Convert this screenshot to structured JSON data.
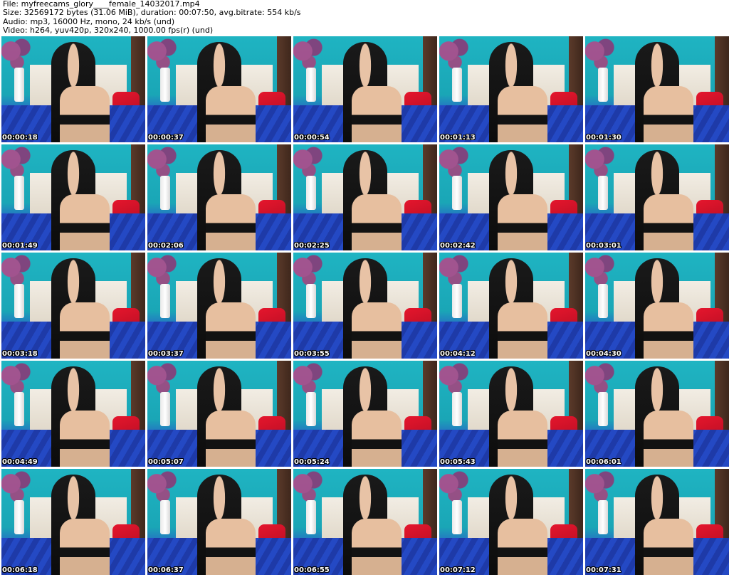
{
  "header": {
    "file_line": "File: myfreecams_glory____female_14032017.mp4",
    "size_line": "Size: 32569172 bytes (31.06 MiB), duration: 00:07:50, avg.bitrate: 554 kb/s",
    "audio_line": "Audio: mp3, 16000 Hz, mono, 24 kb/s (und)",
    "video_line": "Video: h264, yuv420p, 320x240, 1000.00 fps(r) (und)"
  },
  "thumbnails": [
    {
      "timestamp": "00:00:18"
    },
    {
      "timestamp": "00:00:37"
    },
    {
      "timestamp": "00:00:54"
    },
    {
      "timestamp": "00:01:13"
    },
    {
      "timestamp": "00:01:30"
    },
    {
      "timestamp": "00:01:49"
    },
    {
      "timestamp": "00:02:06"
    },
    {
      "timestamp": "00:02:25"
    },
    {
      "timestamp": "00:02:42"
    },
    {
      "timestamp": "00:03:01"
    },
    {
      "timestamp": "00:03:18"
    },
    {
      "timestamp": "00:03:37"
    },
    {
      "timestamp": "00:03:55"
    },
    {
      "timestamp": "00:04:12"
    },
    {
      "timestamp": "00:04:30"
    },
    {
      "timestamp": "00:04:49"
    },
    {
      "timestamp": "00:05:07"
    },
    {
      "timestamp": "00:05:24"
    },
    {
      "timestamp": "00:05:43"
    },
    {
      "timestamp": "00:06:01"
    },
    {
      "timestamp": "00:06:18"
    },
    {
      "timestamp": "00:06:37"
    },
    {
      "timestamp": "00:06:55"
    },
    {
      "timestamp": "00:07:12"
    },
    {
      "timestamp": "00:07:31"
    }
  ]
}
